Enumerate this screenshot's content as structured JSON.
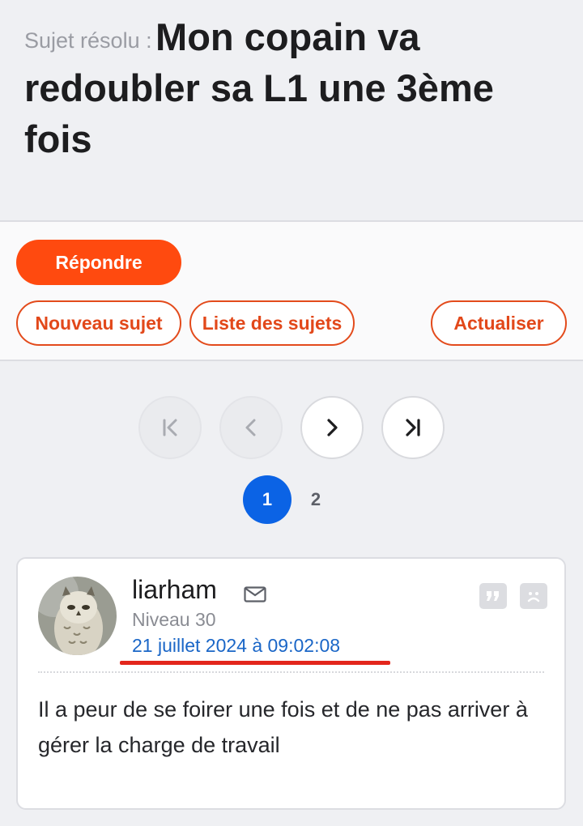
{
  "topic": {
    "resolved_label": "Sujet résolu :",
    "title": "Mon copain va redoubler sa L1 une 3ème fois"
  },
  "actions": {
    "reply_label": "Répondre",
    "new_topic_label": "Nouveau sujet",
    "topic_list_label": "Liste des sujets",
    "refresh_label": "Actualiser"
  },
  "pagination": {
    "first_icon": "first-page-icon",
    "prev_icon": "chevron-left-icon",
    "next_icon": "chevron-right-icon",
    "last_icon": "last-page-icon",
    "pages": [
      "1",
      "2"
    ],
    "current_page": "1"
  },
  "post": {
    "username": "liarham",
    "level": "Niveau 30",
    "date": "21 juillet 2024 à 09:02:08",
    "body": "Il a peur de se foirer une fois et de ne pas arriver à gérer la charge de travail",
    "icons": [
      "mail-icon",
      "quote-icon",
      "report-icon"
    ]
  },
  "colors": {
    "primary": "#ff4a0f",
    "link": "#1a66c7",
    "active_page": "#0b63e5",
    "annotation": "#e3261c"
  }
}
